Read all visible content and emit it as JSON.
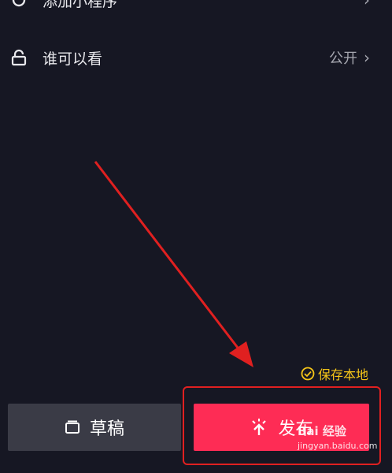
{
  "settings": {
    "top_row_label": "添加小程序",
    "privacy_label": "谁可以看",
    "privacy_value": "公开"
  },
  "save_local_label": "保存本地",
  "buttons": {
    "draft_label": "草稿",
    "publish_label": "发布"
  },
  "watermark": {
    "brand": "Bai 经验",
    "url": "jingyan.baidu.com"
  },
  "colors": {
    "background": "#161723",
    "publish": "#fe2c55",
    "draft": "#3a3b46",
    "save_local": "#f5c518",
    "annotation": "#e02020"
  }
}
